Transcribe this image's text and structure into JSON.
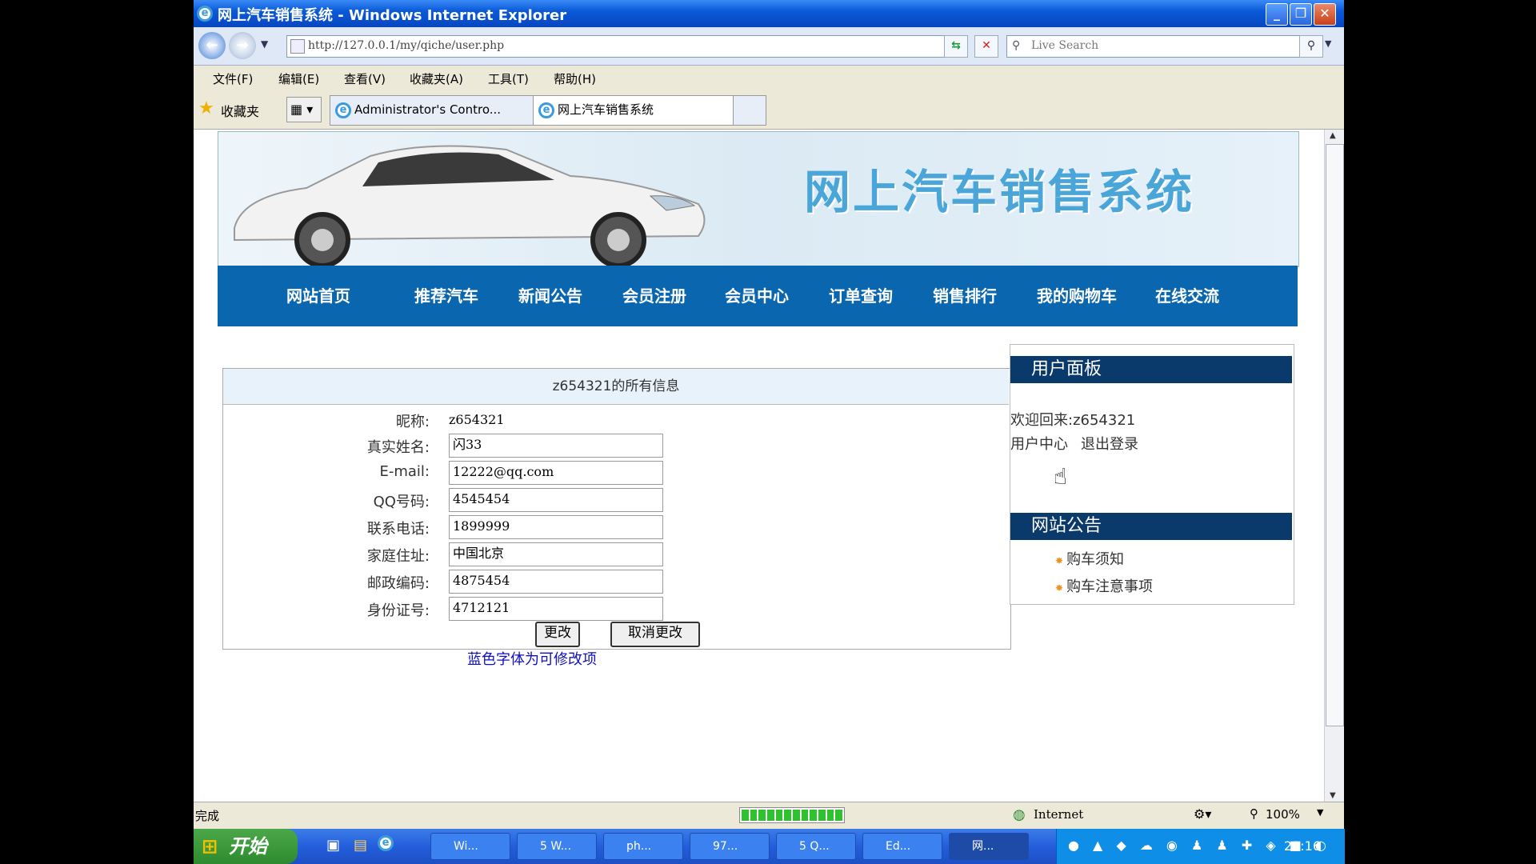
{
  "window": {
    "title": "网上汽车销售系统 - Windows Internet Explorer"
  },
  "browser": {
    "address": "http://127.0.0.1/my/qiche/user.php",
    "search_placeholder": "Live Search",
    "menu": [
      "文件(F)",
      "编辑(E)",
      "查看(V)",
      "收藏夹(A)",
      "工具(T)",
      "帮助(H)"
    ],
    "favorites_label": "收藏夹",
    "tabs": [
      {
        "label": "Administrator's Contro...",
        "active": false
      },
      {
        "label": "网上汽车销售系统",
        "active": true
      }
    ]
  },
  "site": {
    "banner_title": "网上汽车销售系统",
    "nav": [
      "网站首页",
      "推荐汽车",
      "新闻公告",
      "会员注册",
      "会员中心",
      "订单查询",
      "销售排行",
      "我的购物车",
      "在线交流"
    ]
  },
  "profile": {
    "heading": "z654321的所有信息",
    "nickname_label": "昵称:",
    "nickname": "z654321",
    "fields": [
      {
        "label": "真实姓名:",
        "value": "闪33"
      },
      {
        "label": "E-mail:",
        "value": "12222@qq.com"
      },
      {
        "label": "QQ号码:",
        "value": "4545454"
      },
      {
        "label": "联系电话:",
        "value": "1899999"
      },
      {
        "label": "家庭住址:",
        "value": "中国北京"
      },
      {
        "label": "邮政编码:",
        "value": "4875454"
      },
      {
        "label": "身份证号:",
        "value": "4712121"
      }
    ],
    "submit_label": "更改",
    "cancel_label": "取消更改",
    "hint": "蓝色字体为可修改项"
  },
  "sidebar": {
    "user_panel_title": "用户面板",
    "welcome": "欢迎回来:z654321",
    "user_center": "用户中心",
    "logout": "退出登录",
    "notice_title": "网站公告",
    "notices": [
      "购车须知",
      "购车注意事项"
    ]
  },
  "status": {
    "text": "完成",
    "zone": "Internet",
    "zoom": "100%",
    "progress": 1.0
  },
  "taskbar": {
    "start": "开始",
    "tasks": [
      "Wi...",
      "5 W...",
      "ph...",
      "97...",
      "5 Q...",
      "Ed...",
      "网..."
    ],
    "clock": "21:16"
  }
}
